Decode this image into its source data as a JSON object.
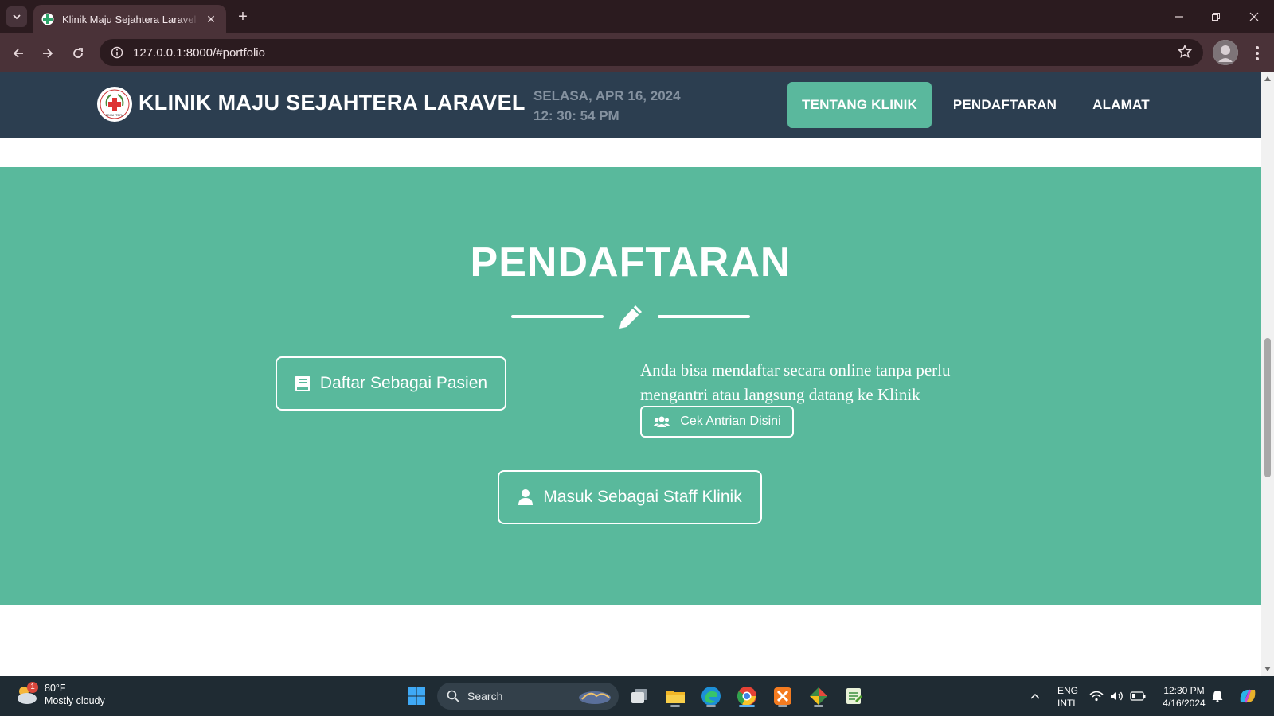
{
  "browser": {
    "tab_title": "Klinik Maju Sejahtera Laravel La",
    "tab_close": "✕",
    "new_tab": "+",
    "url": "127.0.0.1:8000/#portfolio"
  },
  "site": {
    "brand": "KLINIK MAJU SEJAHTERA LARAVEL",
    "logo_text": "SEJAHTERA",
    "date": "SELASA, APR 16, 2024",
    "time": "12: 30: 54 PM",
    "nav": [
      {
        "label": "TENTANG KLINIK",
        "active": true
      },
      {
        "label": "PENDAFTARAN",
        "active": false
      },
      {
        "label": "ALAMAT",
        "active": false
      }
    ],
    "accent": "#59b99c",
    "header_bg": "#2c3e50"
  },
  "section": {
    "title": "PENDAFTARAN",
    "register_patient": "Daftar Sebagai Pasien",
    "description": "Anda bisa mendaftar secara online tanpa perlu mengantri atau langsung datang ke Klinik",
    "check_queue": "Cek Antrian Disini",
    "staff_login": "Masuk Sebagai Staff Klinik"
  },
  "taskbar": {
    "weather_badge": "1",
    "temperature": "80°F",
    "weather_desc": "Mostly cloudy",
    "search_label": "Search",
    "lang_top": "ENG",
    "lang_bottom": "INTL",
    "clock_time": "12:30 PM",
    "clock_date": "4/16/2024"
  }
}
